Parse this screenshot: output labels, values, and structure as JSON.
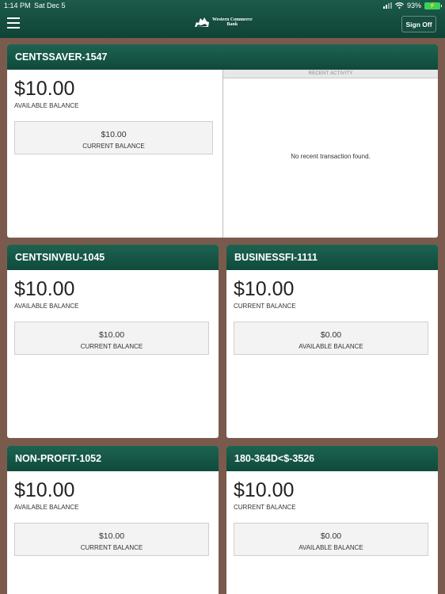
{
  "status_bar": {
    "time": "1:14 PM",
    "date": "Sat Dec 5",
    "battery": "93%"
  },
  "header": {
    "logo_line1": "Western Commerce",
    "logo_line2": "Bank",
    "signoff_label": "Sign Off"
  },
  "accounts": [
    {
      "name": "CENTSSAVER-1547",
      "amount": "$10.00",
      "amount_label": "AVAILABLE BALANCE",
      "sub_value": "$10.00",
      "sub_label": "CURRENT BALANCE",
      "recent_title": "RECENT ACTIVITY",
      "recent_empty": "No recent transaction found."
    },
    {
      "name": "CENTSINVBU-1045",
      "amount": "$10.00",
      "amount_label": "AVAILABLE BALANCE",
      "sub_value": "$10.00",
      "sub_label": "CURRENT BALANCE"
    },
    {
      "name": "BUSINESSFI-1111",
      "amount": "$10.00",
      "amount_label": "CURRENT BALANCE",
      "sub_value": "$0.00",
      "sub_label": "AVAILABLE BALANCE"
    },
    {
      "name": "NON-PROFIT-1052",
      "amount": "$10.00",
      "amount_label": "AVAILABLE BALANCE",
      "sub_value": "$10.00",
      "sub_label": "CURRENT BALANCE"
    },
    {
      "name": "180-364D<$-3526",
      "amount": "$10.00",
      "amount_label": "CURRENT BALANCE",
      "sub_value": "$0.00",
      "sub_label": "AVAILABLE BALANCE"
    }
  ]
}
